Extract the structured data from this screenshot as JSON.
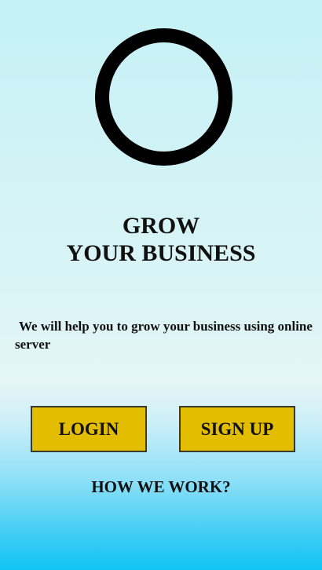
{
  "logo": {
    "icon": "ring-logo-icon",
    "color": "#000000"
  },
  "hero": {
    "title_line1": "GROW",
    "title_line2": "YOUR BUSINESS"
  },
  "tagline": "We will help you to grow your business using online server",
  "buttons": {
    "login_label": "LOGIN",
    "signup_label": "SIGN UP",
    "color": "#e3bd00"
  },
  "how_we_work_label": "HOW WE WORK?"
}
